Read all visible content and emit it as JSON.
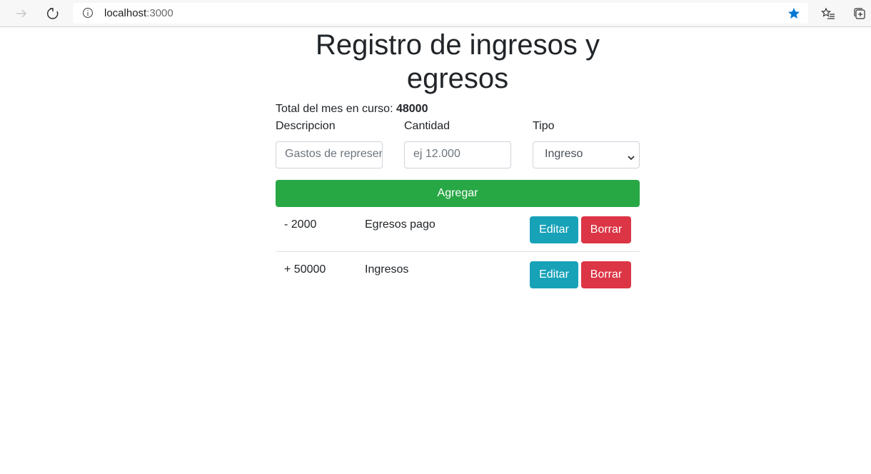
{
  "browser": {
    "url_host": "localhost",
    "url_port": ":3000"
  },
  "page": {
    "title": "Registro de ingresos y egresos",
    "total_label": "Total del mes en curso: ",
    "total_value": "48000"
  },
  "form": {
    "descripcion_label": "Descripcion",
    "descripcion_placeholder": "Gastos de represen",
    "cantidad_label": "Cantidad",
    "cantidad_placeholder": "ej 12.000",
    "tipo_label": "Tipo",
    "tipo_value": "Ingreso",
    "add_button": "Agregar"
  },
  "entries": [
    {
      "amount": "- 2000",
      "description": "Egresos pago",
      "edit_label": "Editar",
      "delete_label": "Borrar"
    },
    {
      "amount": "+ 50000",
      "description": "Ingresos",
      "edit_label": "Editar",
      "delete_label": "Borrar"
    }
  ],
  "colors": {
    "add": "#28a745",
    "edit": "#17a2b8",
    "delete": "#dc3545",
    "star": "#0078d4"
  }
}
